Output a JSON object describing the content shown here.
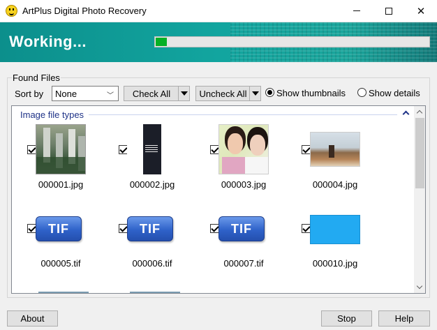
{
  "window": {
    "title": "ArtPlus Digital Photo Recovery",
    "icons": {
      "app": "smiley-icon",
      "minimize": "minimize-icon",
      "maximize": "maximize-icon",
      "close": "close-icon"
    }
  },
  "banner": {
    "status": "Working...",
    "progress_percent": 4,
    "progress_color": "#06b025",
    "background_color": "#12a59f"
  },
  "found_files": {
    "group_label": "Found Files",
    "sort_label": "Sort by",
    "sort_value": "None",
    "check_all_label": "Check All",
    "uncheck_all_label": "Uncheck All",
    "view_options": [
      {
        "label": "Show thumbnails",
        "selected": true
      },
      {
        "label": "Show details",
        "selected": false
      }
    ]
  },
  "file_list": {
    "category": "Image file types",
    "category_color": "#1e3287",
    "files": [
      {
        "name": "000001.jpg",
        "checked": true,
        "kind": "photo",
        "preview": "city-buildings"
      },
      {
        "name": "000002.jpg",
        "checked": true,
        "kind": "photo",
        "preview": "phone-screenshot"
      },
      {
        "name": "000003.jpg",
        "checked": true,
        "kind": "photo",
        "preview": "two-people"
      },
      {
        "name": "000004.jpg",
        "checked": true,
        "kind": "photo",
        "preview": "beach-figure"
      },
      {
        "name": "000005.tif",
        "checked": true,
        "kind": "tif",
        "badge": "TIF"
      },
      {
        "name": "000006.tif",
        "checked": true,
        "kind": "tif",
        "badge": "TIF"
      },
      {
        "name": "000007.tif",
        "checked": true,
        "kind": "tif",
        "badge": "TIF"
      },
      {
        "name": "000010.jpg",
        "checked": true,
        "kind": "photo",
        "preview": "solid-blue",
        "color": "#22aaf2"
      }
    ]
  },
  "buttons": {
    "about": "About",
    "stop": "Stop",
    "help": "Help"
  }
}
